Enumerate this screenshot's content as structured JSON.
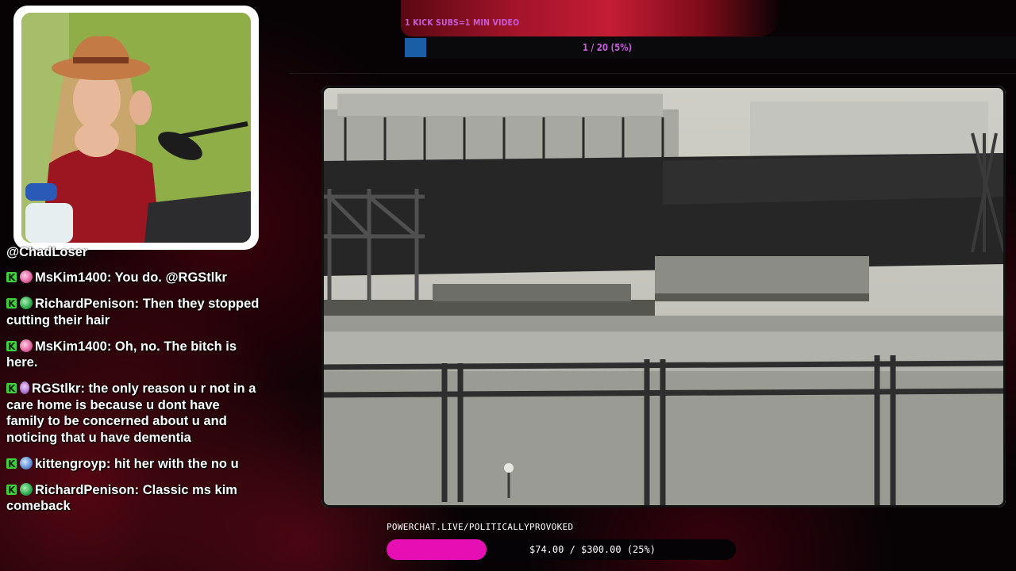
{
  "subs_goal": {
    "title": "1 KICK SUBS=1 MIN VIDEO",
    "current": 1,
    "target": 20,
    "progress_text": "1 / 20 (5%)",
    "progress_fraction": 0.05,
    "fill_color": "#1a5fa6",
    "text_color": "#c75bdc"
  },
  "chat": {
    "partial_top": "@ChadLoser",
    "messages": [
      {
        "platform_icon": "kick-icon",
        "badge": "pink",
        "user": "MsKim1400",
        "text": "You do. @RGStlkr"
      },
      {
        "platform_icon": "kick-icon",
        "badge": "green",
        "user": "RichardPenison",
        "text": "Then they stopped cutting their hair"
      },
      {
        "platform_icon": "kick-icon",
        "badge": "pink",
        "user": "MsKim1400",
        "text": "Oh, no. The bitch is here."
      },
      {
        "platform_icon": "kick-icon",
        "badge": "purple",
        "user": "RGStlkr",
        "text": "the only reason u r not in a care home is because u dont have family to be concerned about u and noticing that u have dementia"
      },
      {
        "platform_icon": "kick-icon",
        "badge": "blue",
        "user": "kittengroyp",
        "text": "hit her with the no u"
      },
      {
        "platform_icon": "kick-icon",
        "badge": "green",
        "user": "RichardPenison",
        "text": "Classic ms kim comeback"
      }
    ]
  },
  "donation_goal": {
    "label": "POWERCHAT.LIVE/POLITICALLYPROVOKED",
    "text": "$74.00 / $300.00 (25%)",
    "progress_fraction": 0.25,
    "fill_color": "#e60fb4"
  },
  "colors": {
    "background": "#070305",
    "accent_red": "#c41d35",
    "kick_green": "#3fd23a"
  }
}
